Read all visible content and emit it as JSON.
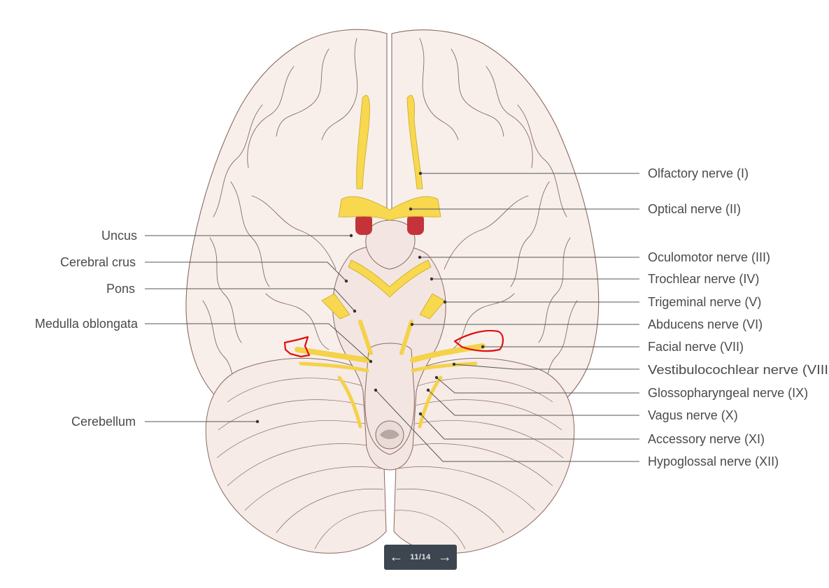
{
  "labels": {
    "left": [
      "Uncus",
      "Cerebral crus",
      "Pons",
      "Medulla oblongata",
      "Cerebellum"
    ],
    "right": [
      "Olfactory nerve (I)",
      "Optical nerve (II)",
      "Oculomotor nerve (III)",
      "Trochlear nerve (IV)",
      "Trigeminal nerve (V)",
      "Abducens nerve (VI)",
      "Facial nerve (VII)",
      "Vestibulocochlear nerve (VIII",
      "Glossopharyngeal nerve (IX)",
      "Vagus nerve (X)",
      "Accessory nerve (XI)",
      "Hypoglossal nerve (XII)"
    ]
  },
  "pager": {
    "prev_icon": "arrow-left-icon",
    "next_icon": "arrow-right-icon",
    "counter": "11/14"
  },
  "colors": {
    "nerve": "#f7d84e",
    "tissue": "#f8efeb",
    "outline": "#8a6a62",
    "annotation": "#e01010",
    "pager_bg": "#3d4650"
  }
}
